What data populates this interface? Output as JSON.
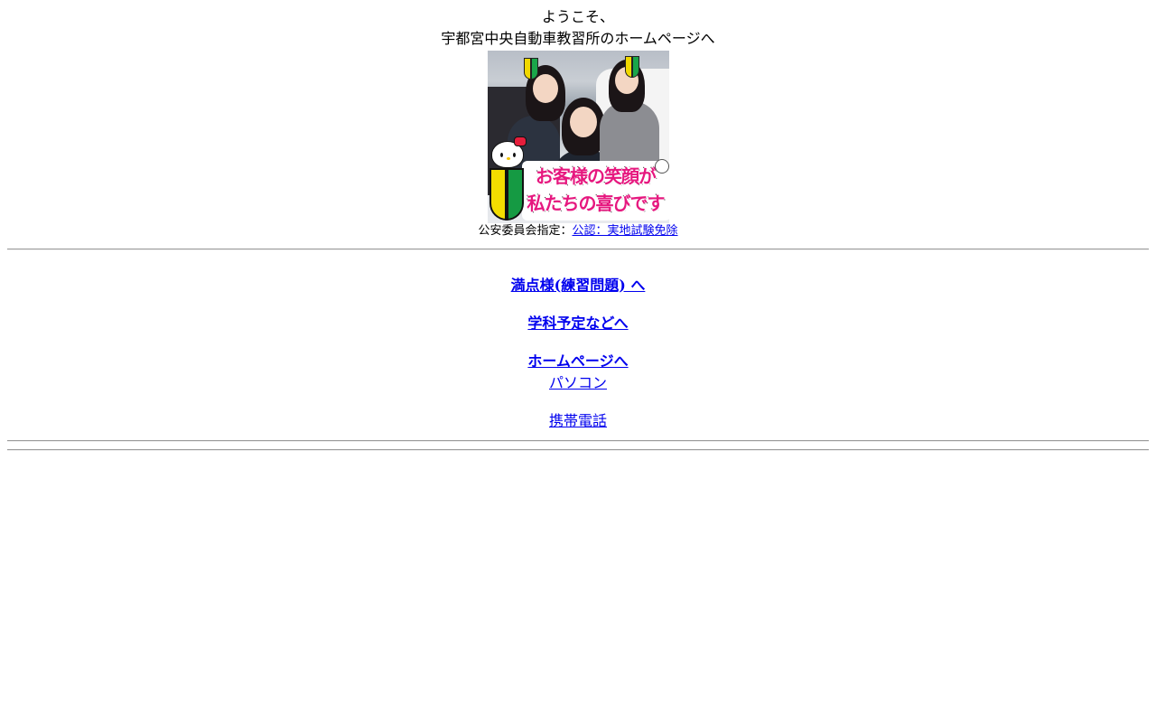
{
  "welcome": {
    "line1": "ようこそ、",
    "line2": "宇都宮中央自動車教習所のホームページへ"
  },
  "hero": {
    "banner_line1": "お客様の笑顔が",
    "banner_line2": "私たちの喜びです"
  },
  "designation": {
    "label": "公安委員会指定：",
    "link": "公認：実地試験免除"
  },
  "nav": {
    "practice": "満点様(練習問題) へ",
    "schedule": "学科予定などへ",
    "homepage": "ホームページへ",
    "pc": "パソコン",
    "mobile": "携帯電話"
  },
  "colors": {
    "link": "#0000ee",
    "banner_text": "#e6187f",
    "rule": "#9a9a9a"
  }
}
